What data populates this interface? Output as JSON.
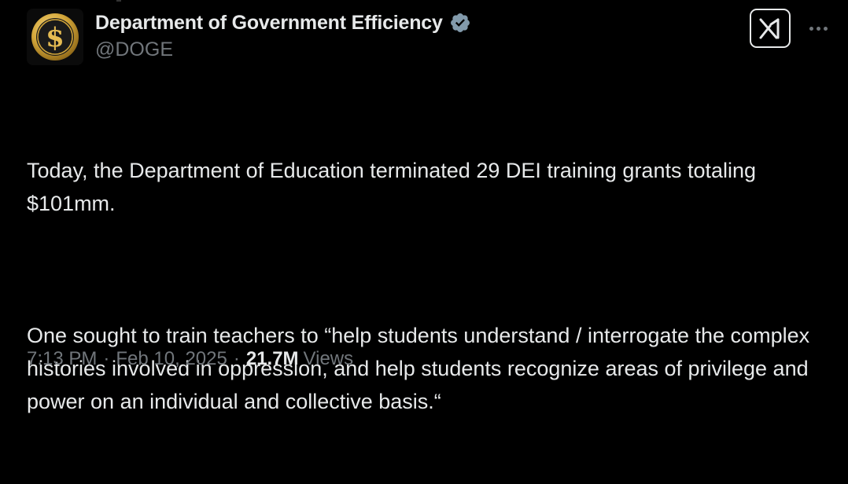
{
  "colors": {
    "background": "#000000",
    "primary_text": "#e7e9ea",
    "secondary_text": "#71767b",
    "verified_badge": "#829aab",
    "avatar_gold": "#d4a73a"
  },
  "author": {
    "display_name": "Department of Government Efficiency",
    "handle": "@DOGE",
    "avatar_icon": "gold-dollar-seal-icon",
    "verified_icon": "verified-badge-icon"
  },
  "header_actions": {
    "grok_icon": "grok-logo-icon",
    "more_icon": "more-horizontal-icon"
  },
  "tweet": {
    "paragraphs": [
      "Today, the Department of Education terminated 29 DEI training grants totaling $101mm.",
      "One sought to train teachers to “help students understand / interrogate the complex histories involved in oppression, and help students recognize areas of privilege and power on an individual and collective basis.“"
    ]
  },
  "meta": {
    "time": "7:13 PM",
    "date": "Feb 10, 2025",
    "separator": "·",
    "views_count": "21.7M",
    "views_label": "Views"
  }
}
